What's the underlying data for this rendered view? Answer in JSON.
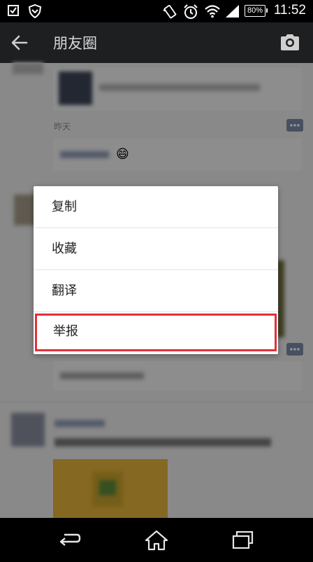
{
  "status_bar": {
    "battery": "80%",
    "time": "11:52",
    "icons": [
      "checkbox-icon",
      "shield-icon",
      "vibrate-icon",
      "alarm-icon",
      "wifi-icon",
      "signal-icon",
      "battery-icon"
    ]
  },
  "action_bar": {
    "title": "朋友圈",
    "back_icon": "arrow-back-icon",
    "camera_icon": "camera-icon"
  },
  "feed": {
    "post1_time": "昨天",
    "post2_emoji": "😄"
  },
  "context_menu": {
    "items": [
      {
        "label": "复制"
      },
      {
        "label": "收藏"
      },
      {
        "label": "翻译"
      },
      {
        "label": "举报"
      }
    ],
    "highlight_color": "#e0303a"
  },
  "nav_bar": {
    "icons": [
      "back-nav-icon",
      "home-icon",
      "recents-icon"
    ]
  }
}
